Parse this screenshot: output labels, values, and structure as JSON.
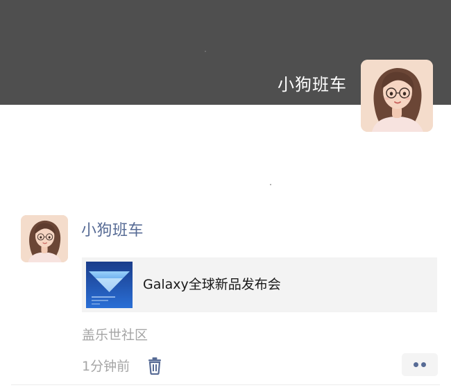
{
  "profile": {
    "cover_color": "#4f4f4f",
    "name": "小狗班车",
    "avatar_icon": "girl-with-glasses-avatar"
  },
  "post": {
    "author": "小狗班车",
    "avatar_icon": "girl-with-glasses-avatar",
    "shared_link": {
      "title": "Galaxy全球新品发布会",
      "thumbnail_icon": "galaxy-event-thumbnail"
    },
    "source": "盖乐世社区",
    "time": "1分钟前",
    "delete_icon": "trash-icon",
    "more_icon": "more-dots-icon"
  },
  "colors": {
    "link_blue": "#576b95",
    "meta_gray": "#a5a5a5",
    "card_bg": "#f3f3f3"
  }
}
